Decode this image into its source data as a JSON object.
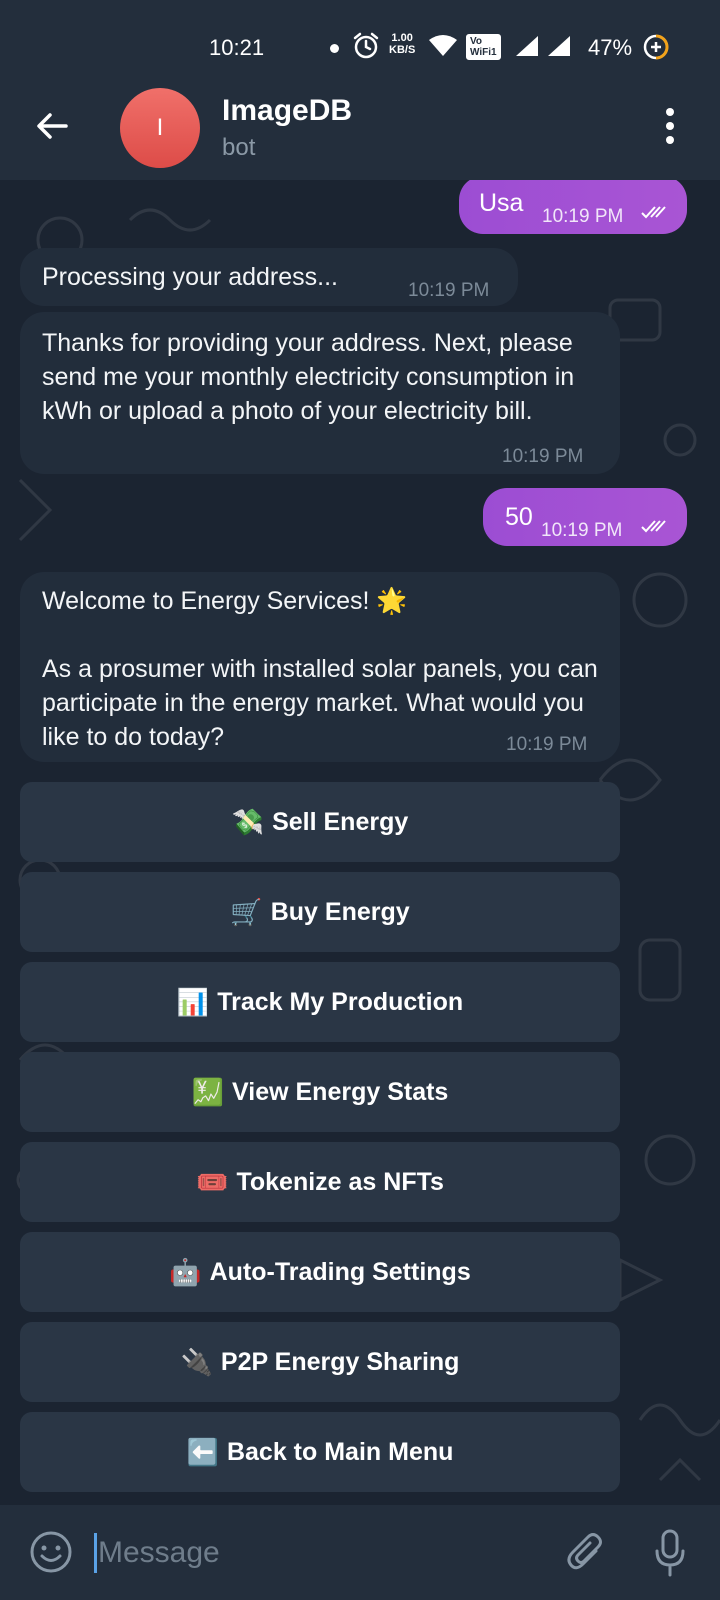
{
  "status_bar": {
    "time": "10:21",
    "speed_value": "1.00",
    "speed_unit": "KB/S",
    "vowifi_top": "Vo",
    "vowifi_bottom": "WiFi",
    "vowifi_num": "1",
    "battery": "47%"
  },
  "header": {
    "avatar_letter": "I",
    "title": "ImageDB",
    "subtitle": "bot"
  },
  "messages": [
    {
      "direction": "out",
      "text": "Usa",
      "time": "10:19 PM"
    },
    {
      "direction": "in",
      "text": "Processing your address...",
      "time": "10:19 PM"
    },
    {
      "direction": "in",
      "text": "Thanks for providing your address. Next, please send me your monthly electricity consumption in kWh or upload a photo of your electricity bill.",
      "time": "10:19 PM"
    },
    {
      "direction": "out",
      "text": "50",
      "time": "10:19 PM"
    },
    {
      "direction": "in",
      "text": "Welcome to Energy Services! 🌟\n\nAs a prosumer with installed solar panels, you can participate in the energy market. What would you like to do today?",
      "time": "10:19 PM"
    }
  ],
  "keyboard": [
    {
      "emoji": "💸",
      "label": "Sell Energy"
    },
    {
      "emoji": "🛒",
      "label": "Buy Energy"
    },
    {
      "emoji": "📊",
      "label": "Track My Production"
    },
    {
      "emoji": "💹",
      "label": "View Energy Stats"
    },
    {
      "emoji": "🎟️",
      "label": "Tokenize as NFTs"
    },
    {
      "emoji": "🤖",
      "label": "Auto-Trading Settings"
    },
    {
      "emoji": "🔌",
      "label": "P2P Energy Sharing"
    },
    {
      "emoji": "⬅️",
      "label": "Back to Main Menu"
    }
  ],
  "composer": {
    "placeholder": "Message"
  },
  "colors": {
    "header_bg": "#232e3c",
    "chat_bg": "#1b2431",
    "incoming_bubble": "#222d3b",
    "outgoing_bubble": "#a052d4",
    "keyboard_button": "#2a3645",
    "avatar": "#e5504c"
  },
  "icons": [
    "back-arrow-icon",
    "more-vertical-icon",
    "emoji-icon",
    "attach-icon",
    "microphone-icon",
    "alarm-icon",
    "wifi-icon",
    "signal-icon",
    "battery-saver-icon",
    "double-check-icon"
  ]
}
